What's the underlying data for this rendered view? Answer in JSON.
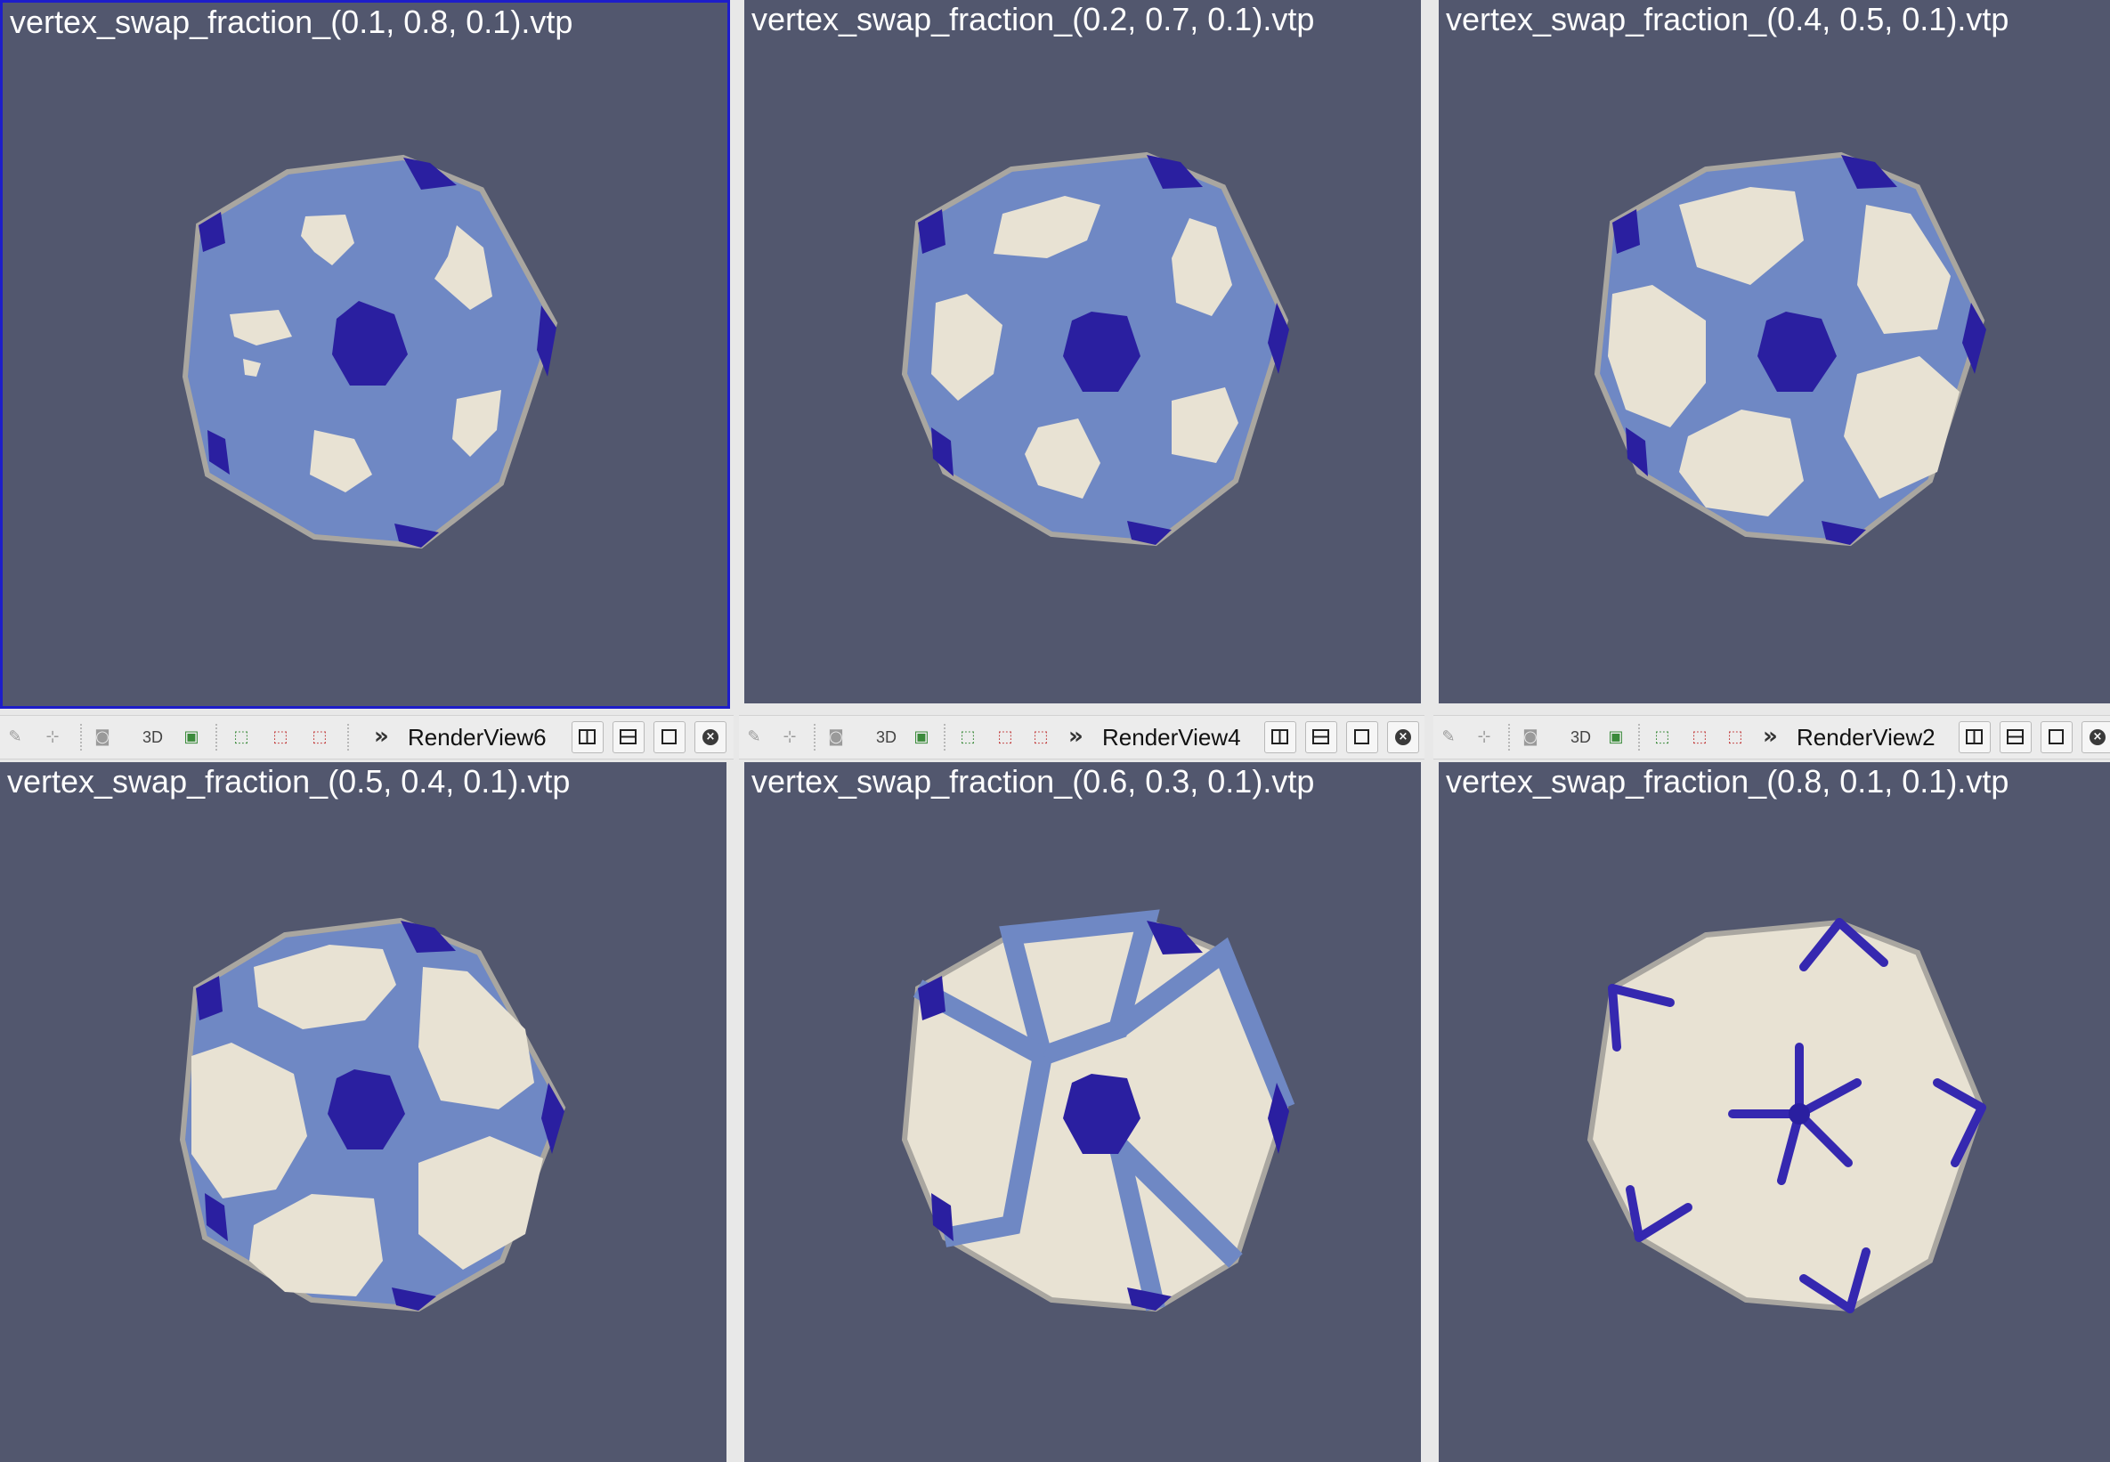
{
  "views": [
    {
      "title": "vertex_swap_fraction_(0.1, 0.8, 0.1).vtp",
      "active": true
    },
    {
      "title": "vertex_swap_fraction_(0.2, 0.7, 0.1).vtp",
      "active": false
    },
    {
      "title": "vertex_swap_fraction_(0.4, 0.5, 0.1).vtp",
      "active": false
    },
    {
      "title": "vertex_swap_fraction_(0.5, 0.4, 0.1).vtp",
      "active": false
    },
    {
      "title": "vertex_swap_fraction_(0.6, 0.3, 0.1).vtp",
      "active": false
    },
    {
      "title": "vertex_swap_fraction_(0.8, 0.1, 0.1).vtp",
      "active": false
    }
  ],
  "toolbars": [
    {
      "label": "RenderView6",
      "mode_3d": "3D"
    },
    {
      "label": "RenderView4",
      "mode_3d": "3D"
    },
    {
      "label": "RenderView2",
      "mode_3d": "3D"
    }
  ],
  "colors": {
    "background": "#52576e",
    "sphere_blue": "#6f88c4",
    "patch_white": "#e8e2d3",
    "vertex_dark": "#2a1fa0",
    "active_border": "#1d1dc9"
  }
}
